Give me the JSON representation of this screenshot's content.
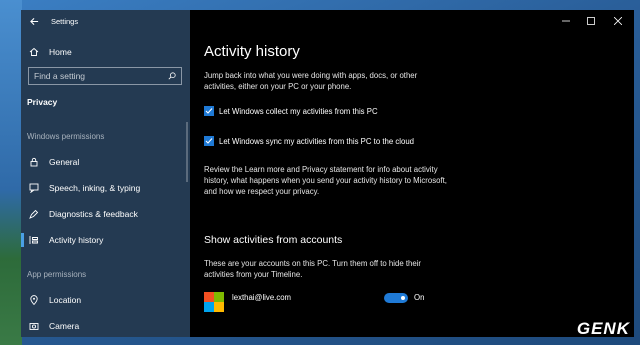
{
  "window": {
    "title": "Settings"
  },
  "sidebar": {
    "home": "Home",
    "search_placeholder": "Find a setting",
    "category": "Privacy",
    "section_windows": "Windows permissions",
    "items": [
      {
        "label": "General",
        "icon": "lock-icon"
      },
      {
        "label": "Speech, inking, & typing",
        "icon": "speech-icon"
      },
      {
        "label": "Diagnostics & feedback",
        "icon": "feedback-icon"
      },
      {
        "label": "Activity history",
        "icon": "timeline-icon",
        "selected": true
      }
    ],
    "section_app": "App permissions",
    "app_items": [
      {
        "label": "Location",
        "icon": "location-icon"
      },
      {
        "label": "Camera",
        "icon": "camera-icon"
      }
    ]
  },
  "main": {
    "title": "Activity history",
    "intro": "Jump back into what you were doing with apps, docs, or other activities, either on your PC or your phone.",
    "checkbox1": {
      "label": "Let Windows collect my activities from this PC",
      "checked": true
    },
    "checkbox2": {
      "label": "Let Windows sync my activities from this PC to the cloud",
      "checked": true
    },
    "review": "Review the Learn more and Privacy statement for info about activity history, what happens when you send your activity history to Microsoft, and how we respect your privacy.",
    "accounts_heading": "Show activities from accounts",
    "accounts_desc": "These are your accounts on this PC. Turn them off to hide their activities from your Timeline.",
    "account": {
      "email": "lexthai@live.com",
      "toggle_state": "On",
      "on": true
    }
  },
  "colors": {
    "accent": "#1f7ad6",
    "sidebar_bg": "#243a52",
    "main_bg": "#000000"
  },
  "watermark": "GENK"
}
